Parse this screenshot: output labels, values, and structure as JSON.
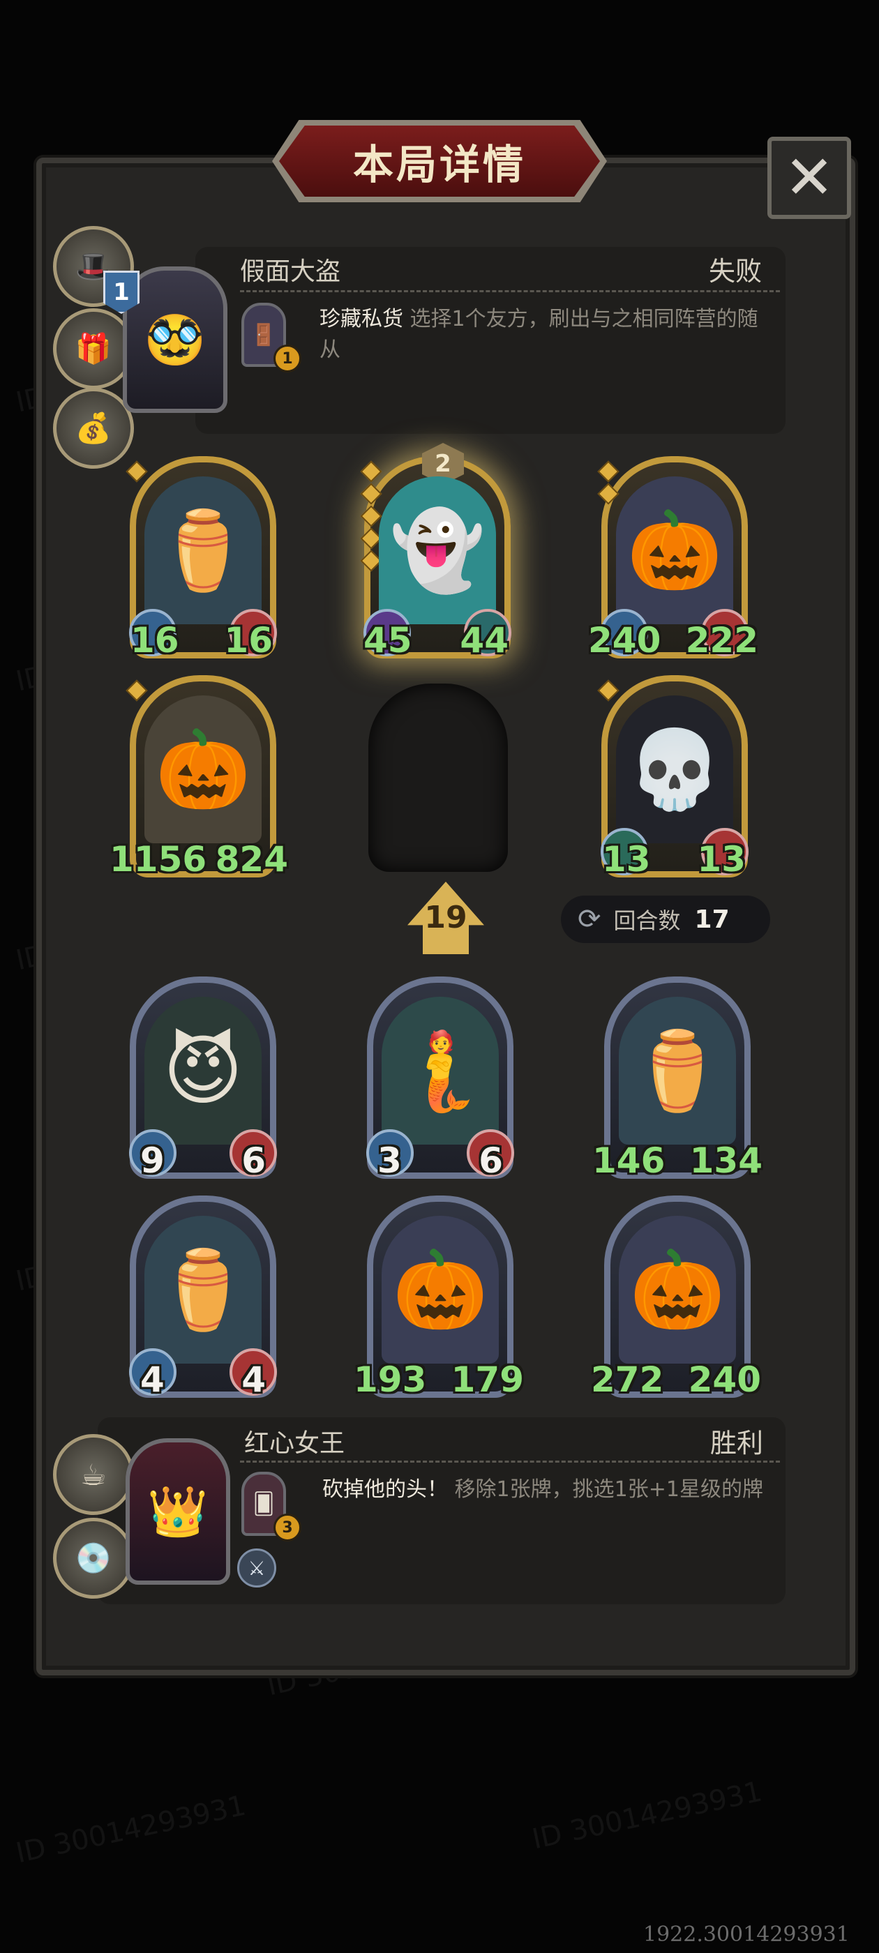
{
  "header": {
    "title": "本局详情",
    "close_glyph": "✕"
  },
  "opponent": {
    "name": "假面大盗",
    "result": "失败",
    "level": "1",
    "skill_name": "珍藏私货",
    "skill_desc": "选择1个友方，刷出与之相同阵营的随从",
    "skill_card_level": "1",
    "icons": [
      "hat-icon",
      "gift-icon",
      "money-bag-icon"
    ]
  },
  "opponent_board": [
    {
      "name": "ghost-urn-minion",
      "attack": "16",
      "health": "16",
      "frame": "gold",
      "stars": 1
    },
    {
      "name": "ghost-pirate-minion",
      "attack": "45",
      "health": "44",
      "frame": "gold",
      "stars": 5,
      "badge": "2"
    },
    {
      "name": "pumpkin-golem-minion",
      "attack": "240",
      "health": "222",
      "frame": "gold",
      "stars": 2
    },
    {
      "name": "pumpkin-mummy-minion",
      "attack": "1156",
      "health": "824",
      "frame": "gold",
      "stars": 1
    },
    {
      "name": "hooded-reaper-minion",
      "attack": "13",
      "health": "13",
      "frame": "gold",
      "stars": 1
    }
  ],
  "tier": "19",
  "turn": {
    "label": "回合数",
    "value": "17"
  },
  "player_board": [
    {
      "name": "horned-elf-minion",
      "attack": "9",
      "health": "6",
      "frame": "silver"
    },
    {
      "name": "sea-maiden-minion",
      "attack": "3",
      "health": "6",
      "frame": "silver"
    },
    {
      "name": "ghost-urn-minion",
      "attack": "146",
      "health": "134",
      "frame": "silver"
    },
    {
      "name": "ghost-urn-minion",
      "attack": "4",
      "health": "4",
      "frame": "silver"
    },
    {
      "name": "pumpkin-golem-minion",
      "attack": "193",
      "health": "179",
      "frame": "silver"
    },
    {
      "name": "pumpkin-golem-minion",
      "attack": "272",
      "health": "240",
      "frame": "silver"
    }
  ],
  "player": {
    "name": "红心女王",
    "result": "胜利",
    "skill_name": "砍掉他的头！",
    "skill_desc": "移除1张牌，挑选1张+1星级的牌",
    "skill_card_level": "3",
    "icons": [
      "teacup-icon",
      "record-icon"
    ]
  },
  "watermark": "ID 30014293931",
  "footer_id": "1922.30014293931"
}
